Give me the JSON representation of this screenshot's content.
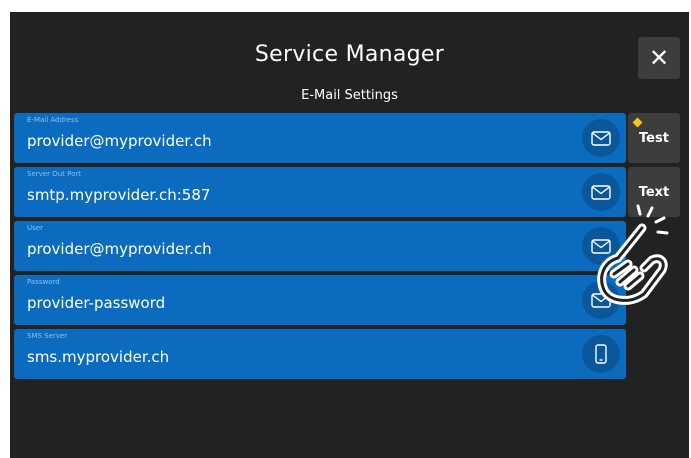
{
  "header": {
    "title": "Service Manager",
    "close_label": "✕"
  },
  "section_title": "E-Mail Settings",
  "fields": [
    {
      "label": "E-Mail Address",
      "value": "provider@myprovider.ch",
      "icon": "envelope-icon"
    },
    {
      "label": "Server Out Port",
      "value": "smtp.myprovider.ch:587",
      "icon": "envelope-icon"
    },
    {
      "label": "User",
      "value": "provider@myprovider.ch",
      "icon": "envelope-icon"
    },
    {
      "label": "Password",
      "value": "provider-password",
      "icon": "envelope-icon"
    },
    {
      "label": "SMS Server",
      "value": "sms.myprovider.ch",
      "icon": "phone-icon"
    }
  ],
  "side_buttons": {
    "test_label": "Test",
    "text_label": "Text"
  },
  "colors": {
    "background": "#222222",
    "field": "#0b6cbf",
    "icon_circle": "#0a579c",
    "side_button": "#3d3d3d",
    "indicator": "#f5c518"
  },
  "overlay": {
    "icon": "tap-hand-icon"
  }
}
